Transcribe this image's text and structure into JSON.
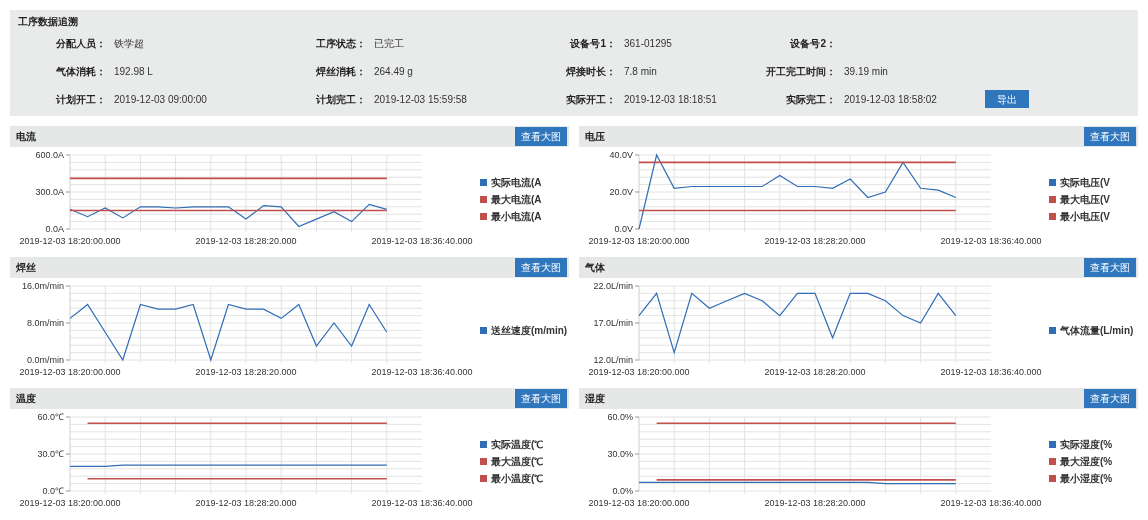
{
  "info_panel": {
    "title": "工序数据追溯",
    "fields": [
      {
        "label": "分配人员：",
        "value": "铁学超"
      },
      {
        "label": "工序状态：",
        "value": "已完工"
      },
      {
        "label": "设备号1：",
        "value": "361-01295"
      },
      {
        "label": "设备号2："
      },
      {
        "label": "气体消耗：",
        "value": "192.98 L"
      },
      {
        "label": "焊丝消耗：",
        "value": "264.49 g"
      },
      {
        "label": "焊接时长：",
        "value": "7.8 min"
      },
      {
        "label": "开工完工时间：",
        "value": "39.19 min"
      },
      {
        "label": "计划开工：",
        "value": "2019-12-03 09:00:00"
      },
      {
        "label": "计划完工：",
        "value": "2019-12-03 15:59:58"
      },
      {
        "label": "实际开工：",
        "value": "2019-12-03 18:18:51"
      },
      {
        "label": "实际完工：",
        "value": "2019-12-03 18:58:02"
      }
    ],
    "export_button": "导出"
  },
  "panels": [
    {
      "title": "电流",
      "button": "查看大图",
      "chart_data": {
        "type": "line",
        "grid": true,
        "legend": "right",
        "categories": [
          "2019-12-03 18:20:00.000",
          null,
          null,
          null,
          null,
          null,
          null,
          null,
          null,
          null,
          "2019-12-03 18:28:20.000",
          null,
          null,
          null,
          null,
          null,
          null,
          null,
          null,
          null,
          "2019-12-03 18:36:40.000"
        ],
        "ylim": [
          0,
          600
        ],
        "yticks": [
          {
            "value": 0,
            "label": "0.0A"
          },
          {
            "value": 300,
            "label": "300.0A"
          },
          {
            "value": 600,
            "label": "600.0A"
          }
        ],
        "series": [
          {
            "name": "实际电流(A",
            "color": "#2f6db5",
            "values": [
              160,
              100,
              170,
              90,
              180,
              180,
              170,
              180,
              180,
              180,
              80,
              190,
              180,
              20,
              80,
              140,
              60,
              200,
              160,
              null,
              null
            ]
          },
          {
            "name": "最大电流(A",
            "color": "#c0504d",
            "values": [
              410,
              410,
              410,
              410,
              410,
              410,
              410,
              410,
              410,
              410,
              410,
              410,
              410,
              410,
              410,
              410,
              410,
              410,
              410,
              null,
              null
            ]
          },
          {
            "name": "最小电流(A",
            "color": "#c0504d",
            "values": [
              150,
              150,
              150,
              150,
              150,
              150,
              150,
              150,
              150,
              150,
              150,
              150,
              150,
              150,
              150,
              150,
              150,
              150,
              150,
              null,
              null
            ]
          }
        ]
      }
    },
    {
      "title": "电压",
      "button": "查看大图",
      "chart_data": {
        "type": "line",
        "grid": true,
        "legend": "right",
        "categories": [
          "2019-12-03 18:20:00.000",
          null,
          null,
          null,
          null,
          null,
          null,
          null,
          null,
          null,
          "2019-12-03 18:28:20.000",
          null,
          null,
          null,
          null,
          null,
          null,
          null,
          null,
          null,
          "2019-12-03 18:36:40.000"
        ],
        "ylim": [
          0,
          40
        ],
        "yticks": [
          {
            "value": 0,
            "label": "0.0V"
          },
          {
            "value": 20,
            "label": "20.0V"
          },
          {
            "value": 40,
            "label": "40.0V"
          }
        ],
        "series": [
          {
            "name": "实际电压(V",
            "color": "#2f6db5",
            "values": [
              0,
              40,
              22,
              23,
              23,
              23,
              23,
              23,
              29,
              23,
              23,
              22,
              27,
              17,
              20,
              36,
              22,
              21,
              17,
              null,
              null
            ]
          },
          {
            "name": "最大电压(V",
            "color": "#c0504d",
            "values": [
              36,
              36,
              36,
              36,
              36,
              36,
              36,
              36,
              36,
              36,
              36,
              36,
              36,
              36,
              36,
              36,
              36,
              36,
              36,
              null,
              null
            ]
          },
          {
            "name": "最小电压(V",
            "color": "#c0504d",
            "values": [
              10,
              10,
              10,
              10,
              10,
              10,
              10,
              10,
              10,
              10,
              10,
              10,
              10,
              10,
              10,
              10,
              10,
              10,
              10,
              null,
              null
            ]
          }
        ]
      }
    },
    {
      "title": "焊丝",
      "button": "查看大图",
      "chart_data": {
        "type": "line",
        "grid": true,
        "legend": "right",
        "categories": [
          "2019-12-03 18:20:00.000",
          null,
          null,
          null,
          null,
          null,
          null,
          null,
          null,
          null,
          "2019-12-03 18:28:20.000",
          null,
          null,
          null,
          null,
          null,
          null,
          null,
          null,
          null,
          "2019-12-03 18:36:40.000"
        ],
        "ylim": [
          0,
          16
        ],
        "yticks": [
          {
            "value": 0,
            "label": "0.0m/min"
          },
          {
            "value": 8,
            "label": "8.0m/min"
          },
          {
            "value": 16,
            "label": "16.0m/min"
          }
        ],
        "series": [
          {
            "name": "送丝速度(m/min)",
            "color": "#2f6db5",
            "values": [
              9,
              12,
              6,
              0,
              12,
              11,
              11,
              12,
              0,
              12,
              11,
              11,
              9,
              12,
              3,
              8,
              3,
              12,
              6,
              null,
              null
            ]
          }
        ]
      }
    },
    {
      "title": "气体",
      "button": "查看大图",
      "chart_data": {
        "type": "line",
        "grid": true,
        "legend": "right",
        "categories": [
          "2019-12-03 18:20:00.000",
          null,
          null,
          null,
          null,
          null,
          null,
          null,
          null,
          null,
          "2019-12-03 18:28:20.000",
          null,
          null,
          null,
          null,
          null,
          null,
          null,
          null,
          null,
          "2019-12-03 18:36:40.000"
        ],
        "ylim": [
          12,
          22
        ],
        "yticks": [
          {
            "value": 12,
            "label": "12.0L/min"
          },
          {
            "value": 17,
            "label": "17.0L/min"
          },
          {
            "value": 22,
            "label": "22.0L/min"
          }
        ],
        "series": [
          {
            "name": "气体流量(L/min)",
            "color": "#2f6db5",
            "values": [
              18,
              21,
              13,
              21,
              19,
              20,
              21,
              20,
              18,
              21,
              21,
              15,
              21,
              21,
              20,
              18,
              17,
              21,
              18,
              null,
              null
            ]
          }
        ]
      }
    },
    {
      "title": "温度",
      "button": "查看大图",
      "chart_data": {
        "type": "line",
        "grid": true,
        "legend": "right",
        "categories": [
          "2019-12-03 18:20:00.000",
          null,
          null,
          null,
          null,
          null,
          null,
          null,
          null,
          null,
          "2019-12-03 18:28:20.000",
          null,
          null,
          null,
          null,
          null,
          null,
          null,
          null,
          null,
          "2019-12-03 18:36:40.000"
        ],
        "ylim": [
          0,
          60
        ],
        "yticks": [
          {
            "value": 0,
            "label": "0.0℃"
          },
          {
            "value": 30,
            "label": "30.0℃"
          },
          {
            "value": 60,
            "label": "60.0℃"
          }
        ],
        "series": [
          {
            "name": "实际温度(℃",
            "color": "#2f6db5",
            "values": [
              20,
              20,
              20,
              21,
              21,
              21,
              21,
              21,
              21,
              21,
              21,
              21,
              21,
              21,
              21,
              21,
              21,
              21,
              21,
              null,
              null
            ]
          },
          {
            "name": "最大温度(℃",
            "color": "#c0504d",
            "values": [
              null,
              55,
              55,
              55,
              55,
              55,
              55,
              55,
              55,
              55,
              55,
              55,
              55,
              55,
              55,
              55,
              55,
              55,
              55,
              null,
              null
            ]
          },
          {
            "name": "最小温度(℃",
            "color": "#c0504d",
            "values": [
              null,
              10,
              10,
              10,
              10,
              10,
              10,
              10,
              10,
              10,
              10,
              10,
              10,
              10,
              10,
              10,
              10,
              10,
              10,
              null,
              null
            ]
          }
        ]
      }
    },
    {
      "title": "湿度",
      "button": "查看大图",
      "chart_data": {
        "type": "line",
        "grid": true,
        "legend": "right",
        "categories": [
          "2019-12-03 18:20:00.000",
          null,
          null,
          null,
          null,
          null,
          null,
          null,
          null,
          null,
          "2019-12-03 18:28:20.000",
          null,
          null,
          null,
          null,
          null,
          null,
          null,
          null,
          null,
          "2019-12-03 18:36:40.000"
        ],
        "ylim": [
          0,
          60
        ],
        "yticks": [
          {
            "value": 0,
            "label": "0.0%"
          },
          {
            "value": 30,
            "label": "30.0%"
          },
          {
            "value": 60,
            "label": "60.0%"
          }
        ],
        "series": [
          {
            "name": "实际湿度(%",
            "color": "#2f6db5",
            "values": [
              7,
              7,
              7,
              7,
              7,
              7,
              7,
              7,
              7,
              7,
              7,
              7,
              7,
              7,
              6,
              6,
              6,
              6,
              6,
              null,
              null
            ]
          },
          {
            "name": "最大湿度(%",
            "color": "#c0504d",
            "values": [
              null,
              55,
              55,
              55,
              55,
              55,
              55,
              55,
              55,
              55,
              55,
              55,
              55,
              55,
              55,
              55,
              55,
              55,
              55,
              null,
              null
            ]
          },
          {
            "name": "最小湿度(%",
            "color": "#c0504d",
            "values": [
              null,
              9,
              9,
              9,
              9,
              9,
              9,
              9,
              9,
              9,
              9,
              9,
              9,
              9,
              9,
              9,
              9,
              9,
              9,
              null,
              null
            ]
          }
        ]
      }
    }
  ]
}
